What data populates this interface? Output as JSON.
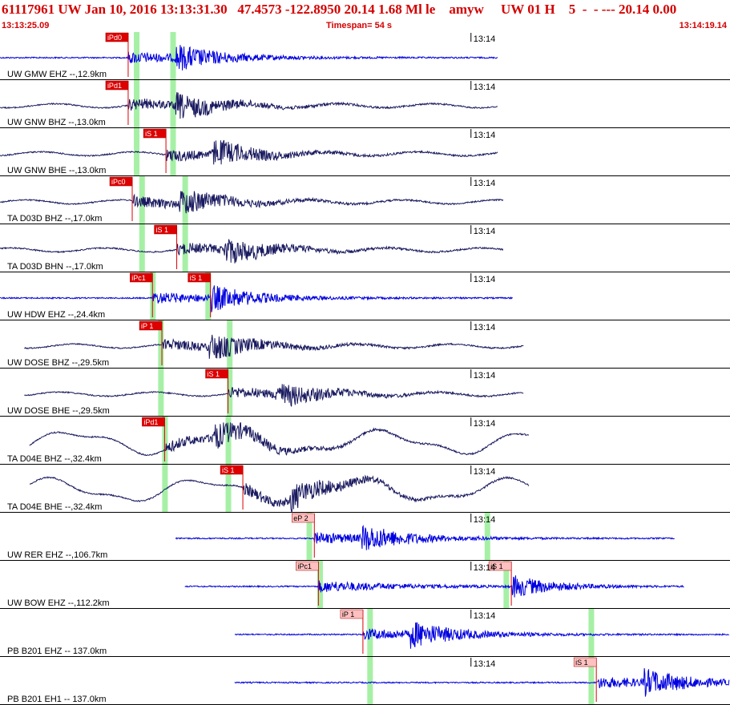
{
  "header": {
    "title": "61117961 UW Jan 10, 2016 13:13:31.30   47.4573 -122.8950 20.14 1.68 Ml le    amyw     UW 01 H    5  -  - --- 20.14 0.00",
    "start_time": "13:13:25.09",
    "timespan": "Timespan=  54 s",
    "end_time": "13:14:19.14"
  },
  "colors": {
    "header_text": "#d40000",
    "trace_blue": "#0000e0",
    "trace_navy": "#1a1a60",
    "pick_fill": "#dd0000",
    "pick_fill_light": "#ffc0c0",
    "window_green": "#a6f0a6",
    "pick_line": "#dd0000"
  },
  "chart_data": {
    "type": "line",
    "x_unit": "seconds after 13:13:25.09",
    "xlim": [
      0,
      54.05
    ],
    "minute_tick_label": "13:14",
    "channels": [
      {
        "label": "UW GMW EHZ --,12.9km",
        "color": "blue",
        "start": 0.0,
        "end": 36.9,
        "picks": [
          {
            "label": "iPd0",
            "t": 9.5,
            "style": "dark"
          }
        ],
        "windows": [
          10.1,
          12.8
        ]
      },
      {
        "label": "UW GNW BHZ --,13.0km",
        "color": "navy",
        "start": 0.0,
        "end": 36.9,
        "picks": [
          {
            "label": "iPd1",
            "t": 9.5,
            "style": "dark"
          }
        ],
        "windows": [
          10.1,
          12.8
        ]
      },
      {
        "label": "UW GNW BHE --,13.0km",
        "color": "navy",
        "start": 0.0,
        "end": 36.9,
        "picks": [
          {
            "label": "iS 1",
            "t": 12.3,
            "style": "dark"
          }
        ],
        "windows": [
          10.1,
          12.8
        ]
      },
      {
        "label": "TA D03D BHZ --,17.0km",
        "color": "navy",
        "start": 0.0,
        "end": 37.3,
        "picks": [
          {
            "label": "iPc0",
            "t": 9.8,
            "style": "dark"
          }
        ],
        "windows": [
          10.5,
          13.7
        ]
      },
      {
        "label": "TA D03D BHN --,17.0km",
        "color": "navy",
        "start": 0.0,
        "end": 37.3,
        "picks": [
          {
            "label": "iS 1",
            "t": 13.1,
            "style": "dark"
          }
        ],
        "windows": [
          10.5,
          13.7
        ]
      },
      {
        "label": "UW HDW EHZ --,24.4km",
        "color": "blue",
        "start": 0.0,
        "end": 38.0,
        "picks": [
          {
            "label": "iPc1",
            "t": 11.3,
            "style": "dark"
          },
          {
            "label": "iS 1",
            "t": 15.6,
            "style": "dark"
          }
        ],
        "windows": [
          11.3,
          15.4
        ]
      },
      {
        "label": "UW DOSE BHZ --,29.5km",
        "color": "navy",
        "start": 1.8,
        "end": 38.8,
        "picks": [
          {
            "label": "iP 1",
            "t": 12.0,
            "style": "dark"
          }
        ],
        "windows": [
          11.9,
          17.0
        ]
      },
      {
        "label": "UW DOSE BHE --,29.5km",
        "color": "navy",
        "start": 1.8,
        "end": 38.8,
        "picks": [
          {
            "label": "iS 1",
            "t": 16.9,
            "style": "dark"
          }
        ],
        "windows": [
          11.9,
          17.0
        ]
      },
      {
        "label": "TA D04E BHZ --,32.4km",
        "color": "navy",
        "start": 2.2,
        "end": 39.2,
        "picks": [
          {
            "label": "iPd1",
            "t": 12.2,
            "style": "dark"
          }
        ],
        "windows": [
          12.2,
          16.9
        ]
      },
      {
        "label": "TA D04E BHE --,32.4km",
        "color": "navy",
        "start": 2.2,
        "end": 39.2,
        "picks": [
          {
            "label": "iS 1",
            "t": 18.0,
            "style": "dark"
          }
        ],
        "windows": [
          12.2,
          16.9
        ]
      },
      {
        "label": "UW RER EHZ --,106.7km",
        "color": "blue",
        "start": 13.0,
        "end": 50.0,
        "picks": [
          {
            "label": "eP 2",
            "t": 23.3,
            "style": "light"
          }
        ],
        "windows": [
          22.9,
          36.1
        ]
      },
      {
        "label": "UW BOW EHZ --,112.2km",
        "color": "blue",
        "start": 13.7,
        "end": 50.7,
        "picks": [
          {
            "label": "iPc1",
            "t": 23.6,
            "style": "light"
          },
          {
            "label": "iS 1",
            "t": 37.9,
            "style": "light"
          }
        ],
        "windows": [
          23.7,
          37.5
        ]
      },
      {
        "label": "PB B201 EHZ -- 137.0km",
        "color": "blue",
        "start": 17.4,
        "end": 54.05,
        "picks": [
          {
            "label": "iP 1",
            "t": 26.9,
            "style": "light"
          }
        ],
        "windows": [
          27.4,
          43.8
        ]
      },
      {
        "label": "PB B201 EH1 -- 137.0km",
        "color": "blue",
        "start": 17.4,
        "end": 54.05,
        "picks": [
          {
            "label": "iS 1",
            "t": 44.2,
            "style": "light"
          }
        ],
        "windows": [
          27.4,
          43.8
        ]
      }
    ]
  }
}
